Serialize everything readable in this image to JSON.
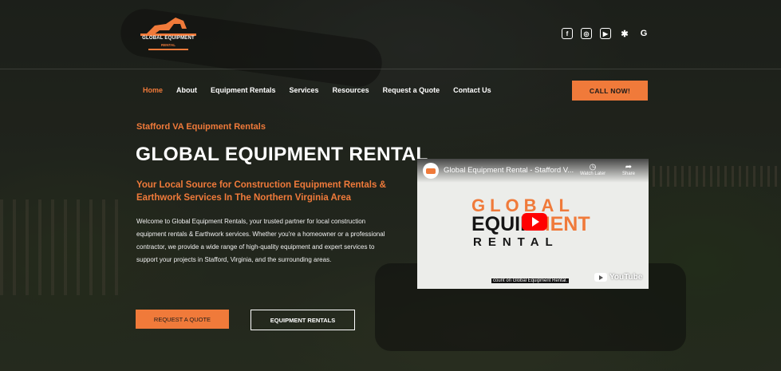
{
  "brand": {
    "logo_text": "GLOBAL EQUIPMENT",
    "logo_sub": "RENTAL",
    "accent_color": "#f07a3a"
  },
  "social": [
    "facebook-icon",
    "instagram-icon",
    "youtube-icon",
    "yelp-icon",
    "google-icon"
  ],
  "nav": {
    "items": [
      "Home",
      "About",
      "Equipment Rentals",
      "Services",
      "Resources",
      "Request a Quote",
      "Contact Us"
    ],
    "active": "Home",
    "call_label": "CALL NOW!"
  },
  "hero": {
    "kicker": "Stafford VA Equipment Rentals",
    "title": "GLOBAL EQUIPMENT RENTAL",
    "subtitle": "Your Local Source for Construction Equipment Rentals & Earthwork Services In The Northern Virginia Area",
    "body": "Welcome to Global Equipment Rentals, your trusted partner for local construction equipment rentals & Earthwork services. Whether you're a homeowner or a professional contractor, we provide a wide range of high-quality equipment and expert services to support your projects in Stafford, Virginia, and the surrounding areas.",
    "quote_button": "REQUEST A QUOTE",
    "rentals_button": "EQUIPMENT RENTALS"
  },
  "video": {
    "title": "Global Equipment Rental - Stafford V...",
    "watch_later": "Watch Later",
    "share": "Share",
    "logo_line1": "GLOBAL",
    "logo_line2_a": "EQUIP",
    "logo_line2_b": "MENT",
    "logo_line3": "RENTAL",
    "caption": "count on Global Equipment Rental.",
    "platform": "YouTube"
  }
}
